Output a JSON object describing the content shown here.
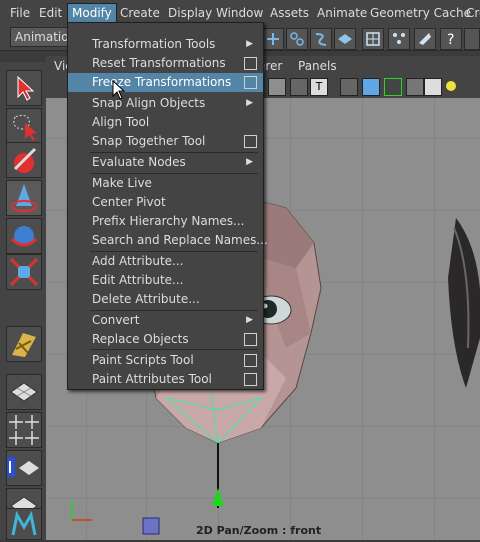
{
  "menubar": {
    "items": [
      "File",
      "Edit",
      "Modify",
      "Create",
      "Display",
      "Window",
      "Assets",
      "Animate",
      "Geometry Cache",
      "Cre"
    ],
    "active": "Modify"
  },
  "toolbar": {
    "menuset": "Animation"
  },
  "viewport": {
    "menu": [
      "Vie",
      "erer",
      "Panels"
    ],
    "label": "2D Pan/Zoom : front"
  },
  "menu": {
    "items": [
      {
        "label": "Transformation Tools",
        "submenu": true
      },
      {
        "label": "Reset Transformations",
        "option": true
      },
      {
        "label": "Freeze Transformations",
        "option": true,
        "highlighted": true
      },
      {
        "label": "Snap Align Objects",
        "submenu": true
      },
      {
        "label": "Align Tool"
      },
      {
        "label": "Snap Together Tool",
        "option": true
      },
      {
        "label": "Evaluate Nodes",
        "submenu": true
      },
      {
        "label": "Make Live"
      },
      {
        "label": "Center Pivot"
      },
      {
        "label": "Prefix Hierarchy Names..."
      },
      {
        "label": "Search and Replace Names..."
      },
      {
        "label": "Add Attribute..."
      },
      {
        "label": "Edit Attribute..."
      },
      {
        "label": "Delete Attribute..."
      },
      {
        "label": "Convert",
        "submenu": true
      },
      {
        "label": "Replace Objects",
        "option": true
      },
      {
        "label": "Paint Scripts Tool",
        "option": true
      },
      {
        "label": "Paint Attributes Tool",
        "option": true
      }
    ]
  },
  "colors": {
    "highlight": "#5285a6",
    "menu_bg": "#444444",
    "viewport_bg": "#8e8e8e"
  }
}
